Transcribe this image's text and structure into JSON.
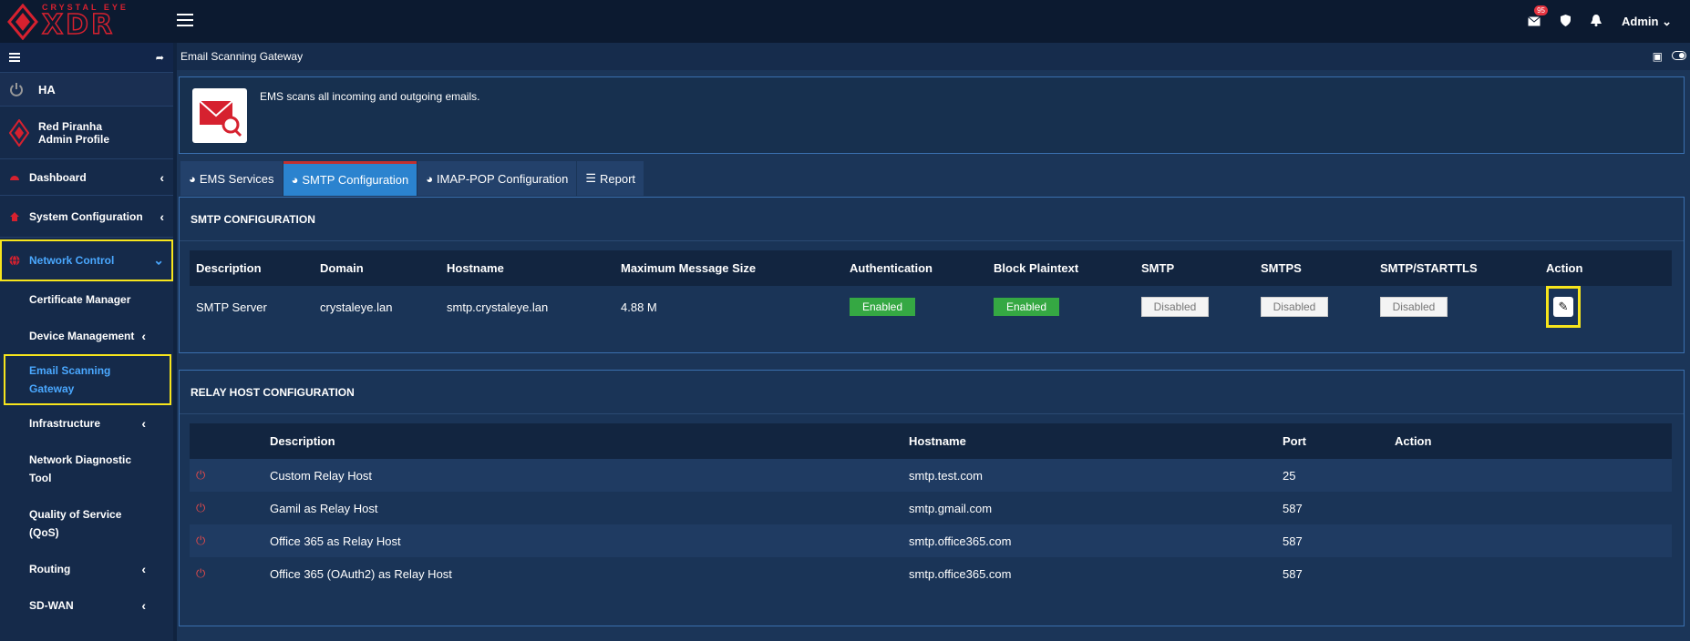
{
  "brand": {
    "top": "CRYSTAL EYE",
    "bottom": "XDR"
  },
  "topbar": {
    "mail_badge": "95",
    "admin_label": "Admin"
  },
  "sidebar": {
    "ha_label": "HA",
    "profile_name": "Red Piranha",
    "profile_sub": "Admin Profile",
    "items": [
      {
        "label": "Dashboard"
      },
      {
        "label": "System Configuration"
      },
      {
        "label": "Network Control"
      }
    ],
    "sub_items": [
      {
        "label": "Certificate Manager"
      },
      {
        "label": "Device Management"
      },
      {
        "label": "Email Scanning",
        "label2": "Gateway"
      },
      {
        "label": "Infrastructure"
      },
      {
        "label": "Network Diagnostic",
        "label2": "Tool"
      },
      {
        "label": "Quality of Service",
        "label2": "(QoS)"
      },
      {
        "label": "Routing"
      },
      {
        "label": "SD-WAN"
      }
    ]
  },
  "page": {
    "title": "Email Scanning Gateway",
    "info_text": "EMS scans all incoming and outgoing emails."
  },
  "tabs": [
    {
      "label": "EMS Services"
    },
    {
      "label": "SMTP Configuration"
    },
    {
      "label": "IMAP-POP Configuration"
    },
    {
      "label": "Report"
    }
  ],
  "smtp": {
    "title": "SMTP CONFIGURATION",
    "headers": [
      "Description",
      "Domain",
      "Hostname",
      "Maximum Message Size",
      "Authentication",
      "Block Plaintext",
      "SMTP",
      "SMTPS",
      "SMTP/STARTTLS",
      "Action"
    ],
    "row": {
      "description": "SMTP Server",
      "domain": "crystaleye.lan",
      "hostname": "smtp.crystaleye.lan",
      "max_size": "4.88 M",
      "authentication": "Enabled",
      "block_plaintext": "Enabled",
      "smtp": "Disabled",
      "smtps": "Disabled",
      "starttls": "Disabled"
    }
  },
  "relay": {
    "title": "RELAY HOST CONFIGURATION",
    "headers": [
      "Description",
      "Hostname",
      "Port",
      "Action"
    ],
    "rows": [
      {
        "description": "Custom Relay Host",
        "hostname": "smtp.test.com",
        "port": "25"
      },
      {
        "description": "Gamil as Relay Host",
        "hostname": "smtp.gmail.com",
        "port": "587"
      },
      {
        "description": "Office 365 as Relay Host",
        "hostname": "smtp.office365.com",
        "port": "587"
      },
      {
        "description": "Office 365 (OAuth2) as Relay Host",
        "hostname": "smtp.office365.com",
        "port": "587"
      }
    ]
  },
  "colors": {
    "accent": "#2b83cf",
    "enabled": "#35a843",
    "highlight": "#f7e51c",
    "brand_red": "#d6212f"
  }
}
